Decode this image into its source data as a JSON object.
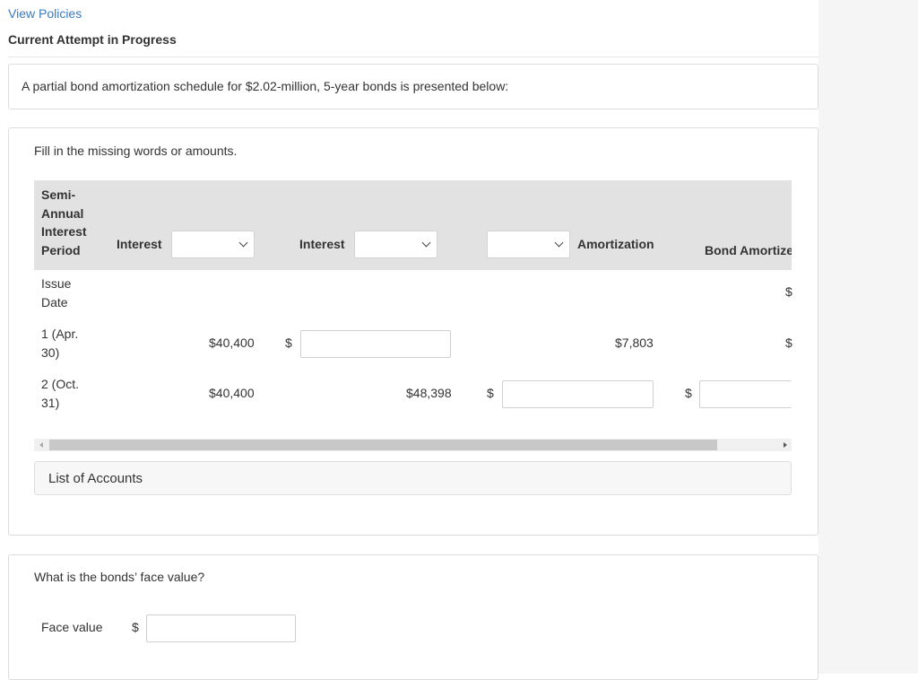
{
  "header": {
    "view_policies": "View Policies",
    "attempt_status": "Current Attempt in Progress"
  },
  "intro": {
    "text": "A partial bond amortization schedule for $2.02-million, 5-year bonds is presented below:"
  },
  "exercise": {
    "instruction": "Fill in the missing words or amounts.",
    "columns": {
      "period": [
        "Semi-",
        "Annual",
        "Interest",
        "Period"
      ],
      "interest_1": "Interest",
      "interest_2": "Interest",
      "amortization": "Amortization",
      "bond_amortize": "Bond Amortize",
      "dropdown_1": "",
      "dropdown_2": "",
      "dropdown_3": ""
    },
    "rows": [
      {
        "period": [
          "Issue",
          "Date"
        ],
        "col1": "",
        "col3": "",
        "col5": "",
        "last_dollar": "$"
      },
      {
        "period": [
          "1 (Apr.",
          "30)"
        ],
        "col1": "$40,400",
        "col2_dollar": "$",
        "col5": "$7,803",
        "last_dollar": "$"
      },
      {
        "period": [
          "2 (Oct.",
          "31)"
        ],
        "col1": "$40,400",
        "col3": "$48,398",
        "col4_dollar": "$",
        "last_dollar": "$"
      }
    ],
    "list_of_accounts": "List of Accounts"
  },
  "question": {
    "text": "What is the bonds’ face value?",
    "face_value_label": "Face value",
    "dollar": "$",
    "face_value": ""
  }
}
